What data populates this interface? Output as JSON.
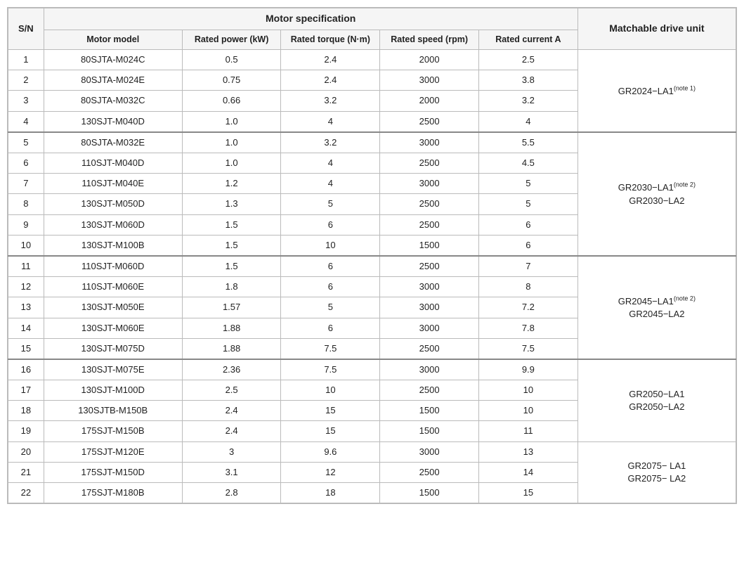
{
  "table": {
    "title": "Motor specification",
    "matchable_col": "Matchable drive unit",
    "headers": {
      "sn": "S/N",
      "model": "Motor model",
      "power": "Rated power (kW)",
      "torque": "Rated torque (N·m)",
      "speed": "Rated speed (rpm)",
      "current": "Rated current A"
    },
    "rows": [
      {
        "sn": "1",
        "model": "80SJTA-M024C",
        "power": "0.5",
        "torque": "2.4",
        "speed": "2000",
        "current": "2.5",
        "drive": "",
        "drive_note": "",
        "group_start": true
      },
      {
        "sn": "2",
        "model": "80SJTA-M024E",
        "power": "0.75",
        "torque": "2.4",
        "speed": "3000",
        "current": "3.8",
        "drive": "GR2024-LA1",
        "drive_note": "note 1",
        "group_start": false
      },
      {
        "sn": "3",
        "model": "80SJTA-M032C",
        "power": "0.66",
        "torque": "3.2",
        "speed": "2000",
        "current": "3.2",
        "drive": "",
        "drive_note": "",
        "group_start": false
      },
      {
        "sn": "4",
        "model": "130SJT-M040D",
        "power": "1.0",
        "torque": "4",
        "speed": "2500",
        "current": "4",
        "drive": "",
        "drive_note": "",
        "group_start": false
      },
      {
        "sn": "5",
        "model": "80SJTA-M032E",
        "power": "1.0",
        "torque": "3.2",
        "speed": "3000",
        "current": "5.5",
        "drive": "",
        "drive_note": "",
        "group_start": true
      },
      {
        "sn": "6",
        "model": "110SJT-M040D",
        "power": "1.0",
        "torque": "4",
        "speed": "2500",
        "current": "4.5",
        "drive": "",
        "drive_note": "",
        "group_start": false
      },
      {
        "sn": "7",
        "model": "110SJT-M040E",
        "power": "1.2",
        "torque": "4",
        "speed": "3000",
        "current": "5",
        "drive": "GR2030-LA1",
        "drive_note": "note 2",
        "group_start": false
      },
      {
        "sn": "8",
        "model": "130SJT-M050D",
        "power": "1.3",
        "torque": "5",
        "speed": "2500",
        "current": "5",
        "drive": "GR2030-LA2",
        "drive_note": "",
        "group_start": false
      },
      {
        "sn": "9",
        "model": "130SJT-M060D",
        "power": "1.5",
        "torque": "6",
        "speed": "2500",
        "current": "6",
        "drive": "",
        "drive_note": "",
        "group_start": false
      },
      {
        "sn": "10",
        "model": "130SJT-M100B",
        "power": "1.5",
        "torque": "10",
        "speed": "1500",
        "current": "6",
        "drive": "",
        "drive_note": "",
        "group_start": false
      },
      {
        "sn": "11",
        "model": "110SJT-M060D",
        "power": "1.5",
        "torque": "6",
        "speed": "2500",
        "current": "7",
        "drive": "",
        "drive_note": "",
        "group_start": true
      },
      {
        "sn": "12",
        "model": "110SJT-M060E",
        "power": "1.8",
        "torque": "6",
        "speed": "3000",
        "current": "8",
        "drive": "GR2045-LA1",
        "drive_note": "note 2",
        "group_start": false
      },
      {
        "sn": "13",
        "model": "130SJT-M050E",
        "power": "1.57",
        "torque": "5",
        "speed": "3000",
        "current": "7.2",
        "drive": "GR2045-LA2",
        "drive_note": "",
        "group_start": false
      },
      {
        "sn": "14",
        "model": "130SJT-M060E",
        "power": "1.88",
        "torque": "6",
        "speed": "3000",
        "current": "7.8",
        "drive": "",
        "drive_note": "",
        "group_start": false
      },
      {
        "sn": "15",
        "model": "130SJT-M075D",
        "power": "1.88",
        "torque": "7.5",
        "speed": "2500",
        "current": "7.5",
        "drive": "",
        "drive_note": "",
        "group_start": false
      },
      {
        "sn": "16",
        "model": "130SJT-M075E",
        "power": "2.36",
        "torque": "7.5",
        "speed": "3000",
        "current": "9.9",
        "drive": "",
        "drive_note": "",
        "group_start": true
      },
      {
        "sn": "17",
        "model": "130SJT-M100D",
        "power": "2.5",
        "torque": "10",
        "speed": "2500",
        "current": "10",
        "drive": "GR2050-LA1",
        "drive_note": "",
        "group_start": false
      },
      {
        "sn": "18",
        "model": "130SJTB-M150B",
        "power": "2.4",
        "torque": "15",
        "speed": "1500",
        "current": "10",
        "drive": "GR2050-LA2",
        "drive_note": "",
        "group_start": false
      },
      {
        "sn": "19",
        "model": "175SJT-M150B",
        "power": "2.4",
        "torque": "15",
        "speed": "1500",
        "current": "11",
        "drive": "",
        "drive_note": "",
        "group_start": false
      },
      {
        "sn": "20",
        "model": "175SJT-M120E",
        "power": "3",
        "torque": "9.6",
        "speed": "3000",
        "current": "13",
        "drive": "GR2075- LA1",
        "drive_note": "",
        "group_start": false
      },
      {
        "sn": "21",
        "model": "175SJT-M150D",
        "power": "3.1",
        "torque": "12",
        "speed": "2500",
        "current": "14",
        "drive": "GR2075- LA2",
        "drive_note": "",
        "group_start": false
      },
      {
        "sn": "22",
        "model": "175SJT-M180B",
        "power": "2.8",
        "torque": "18",
        "speed": "1500",
        "current": "15",
        "drive": "",
        "drive_note": "",
        "group_start": false
      }
    ]
  }
}
